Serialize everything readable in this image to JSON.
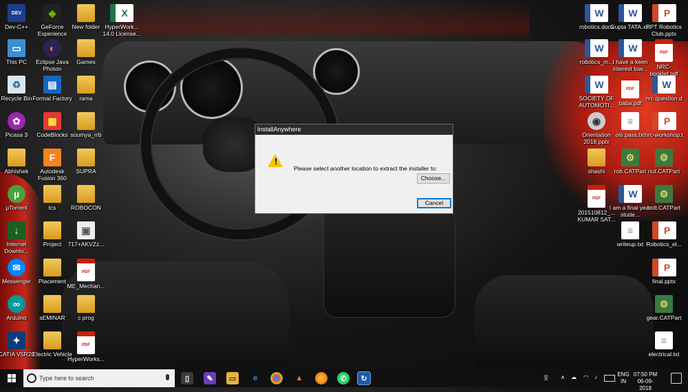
{
  "dialog": {
    "title": "InstallAnywhere",
    "message": "Please select another location to extract the installer to:",
    "choose_label": "Choose...",
    "cancel_label": "Cancel"
  },
  "desktop": {
    "icons": [
      {
        "label": "Dev-C++",
        "icon": "devcpp-icon"
      },
      {
        "label": "GeForce Experience",
        "icon": "geforce-icon"
      },
      {
        "label": "New folder",
        "icon": "folder-icon"
      },
      {
        "label": "HyperWork... 14.0 License...",
        "icon": "excel-icon"
      },
      {
        "label": "This PC",
        "icon": "computer-icon"
      },
      {
        "label": "Eclipse Java Photon",
        "icon": "eclipse-icon"
      },
      {
        "label": "Games",
        "icon": "folder-icon"
      },
      {
        "label": "Recycle Bin",
        "icon": "recycle-bin-icon"
      },
      {
        "label": "Format Factory",
        "icon": "format-factory-icon"
      },
      {
        "label": "rama",
        "icon": "folder-icon"
      },
      {
        "label": "Picasa 3",
        "icon": "picasa-icon"
      },
      {
        "label": "CodeBlocks",
        "icon": "codeblocks-icon"
      },
      {
        "label": "soumya_rrb",
        "icon": "folder-icon"
      },
      {
        "label": "Abhishek",
        "icon": "folder-icon"
      },
      {
        "label": "Autodesk Fusion 360",
        "icon": "fusion360-icon"
      },
      {
        "label": "SUPRA",
        "icon": "folder-icon"
      },
      {
        "label": "µTorrent",
        "icon": "utorrent-icon"
      },
      {
        "label": "tcs",
        "icon": "folder-icon"
      },
      {
        "label": "ROBOCON",
        "icon": "folder-icon"
      },
      {
        "label": "Internet Downlo...",
        "icon": "idm-icon"
      },
      {
        "label": "Project",
        "icon": "folder-icon"
      },
      {
        "label": "717+AKVZz...",
        "icon": "image-file-icon"
      },
      {
        "label": "Messenger",
        "icon": "messenger-icon"
      },
      {
        "label": "Placement",
        "icon": "folder-icon"
      },
      {
        "label": "ME_Mechan...",
        "icon": "pdf-icon"
      },
      {
        "label": "Arduino",
        "icon": "arduino-icon"
      },
      {
        "label": "sEMINAR",
        "icon": "folder-icon"
      },
      {
        "label": "c prog",
        "icon": "folder-icon"
      },
      {
        "label": "CATIA V5R20",
        "icon": "catia-icon"
      },
      {
        "label": "Electric Vehicle",
        "icon": "folder-icon"
      },
      {
        "label": "HyperWorks...",
        "icon": "pdf-icon"
      },
      {
        "label": "robotics.docx",
        "icon": "word-icon"
      },
      {
        "label": "Gupta TATA.xls",
        "icon": "word-icon"
      },
      {
        "label": "PPT Robotics Club.pptx",
        "icon": "ppt-icon"
      },
      {
        "label": "robotics_m...",
        "icon": "word-icon"
      },
      {
        "label": "I have a keen interest tow...",
        "icon": "word-icon"
      },
      {
        "label": "NRC-booklet.pdf",
        "icon": "pdf-icon"
      },
      {
        "label": "SOCIETY OF AUTOMOTI...",
        "icon": "word-icon"
      },
      {
        "label": "baba.pdf",
        "icon": "pdf-icon"
      },
      {
        "label": "nrc question.d",
        "icon": "word-icon"
      },
      {
        "label": "Orientation 2018.pptx",
        "icon": "orientation-icon"
      },
      {
        "label": "ois pass.txt",
        "icon": "text-file-icon"
      },
      {
        "label": "nrc-workshop.t",
        "icon": "ppt-icon"
      },
      {
        "label": "shashi",
        "icon": "folder-icon"
      },
      {
        "label": "rob.CATPart",
        "icon": "catpart-icon"
      },
      {
        "label": "nut.CATPart",
        "icon": "catpart-icon"
      },
      {
        "label": "201510812_... KUMAR SAT...",
        "icon": "pdf-icon"
      },
      {
        "label": "I am a final year stude...",
        "icon": "word-icon"
      },
      {
        "label": "bolt.CATPart",
        "icon": "catpart-icon"
      },
      {
        "label": "writeup.txt",
        "icon": "text-file-icon"
      },
      {
        "label": "Robotics_el...",
        "icon": "ppt-icon"
      },
      {
        "label": "final.pptx",
        "icon": "ppt-icon"
      },
      {
        "label": "gear.CATPart",
        "icon": "catpart-icon"
      },
      {
        "label": "electrical.txt",
        "icon": "text-file-icon"
      }
    ]
  },
  "taskbar": {
    "search_placeholder": "Type here to search",
    "language_line1": "ENG",
    "language_line2": "IN",
    "time": "07:50 PM",
    "date": "06-09-2018"
  },
  "colors": {
    "taskbar_bg": "#101010",
    "dialog_bg": "#f0f0f0",
    "dialog_title_bg": "#2b2b2b",
    "accent": "#0078d7"
  }
}
